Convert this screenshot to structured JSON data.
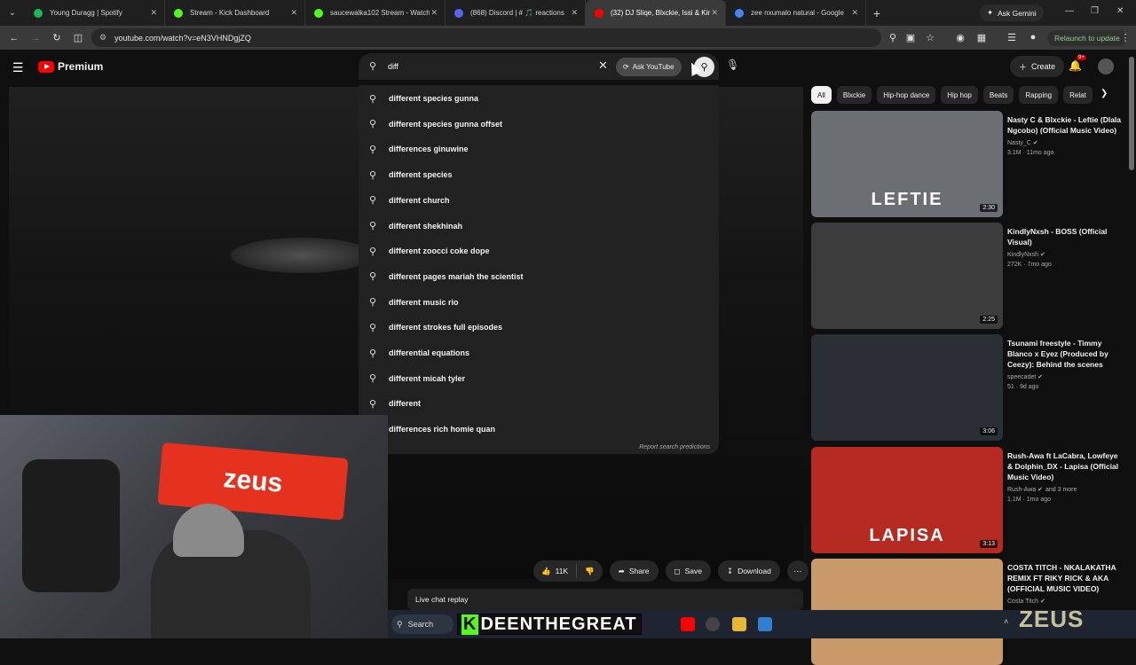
{
  "browser": {
    "tabs": [
      {
        "title": "Young Duragg | Spotify",
        "color": "#1db954",
        "active": false
      },
      {
        "title": "Stream - Kick Dashboard",
        "color": "#53fc18",
        "active": false
      },
      {
        "title": "saucewalka102 Stream - Watch",
        "color": "#53fc18",
        "active": false
      },
      {
        "title": "(868) Discord | # 🎵 reactions",
        "color": "#5865f2",
        "active": false
      },
      {
        "title": "(32) DJ Sliqe, Blxckie, Issi & Kin",
        "color": "#ff0000",
        "active": true
      },
      {
        "title": "zee nxumalo natural - Google",
        "color": "#4285f4",
        "active": false
      }
    ],
    "new_tab": "+",
    "gemini_label": "Ask Gemini",
    "url": "youtube.com/watch?v=eN3VHNDgjZQ",
    "relaunch_label": "Relaunch to update"
  },
  "youtube": {
    "logo_text": "Premium",
    "search": {
      "value": "diff",
      "ask_label": "Ask YouTube",
      "suggestions": [
        "different species gunna",
        "different species gunna offset",
        "differences ginuwine",
        "different species",
        "different church",
        "different shekhinah",
        "different zoocci coke dope",
        "different pages mariah the scientist",
        "different music rio",
        "different strokes full episodes",
        "differential equations",
        "different micah tyler",
        "different",
        "differences rich homie quan"
      ],
      "report_label": "Report search predictions"
    },
    "create_label": "Create",
    "notif_count": "9+",
    "actions": {
      "likes": "11K",
      "share": "Share",
      "save": "Save",
      "download": "Download"
    },
    "live_chat": "Live chat replay",
    "chips": [
      "All",
      "Blxckie",
      "Hip-hop dance",
      "Hip hop",
      "Beats",
      "Rapping",
      "Relat"
    ],
    "recommendations": [
      {
        "title": "Nasty C & Blxckie - Leftie (Dlala Ngcobo) (Official Music Video)",
        "channel": "Nasty_C",
        "meta": "3.1M · 11mo ago",
        "duration": "2:30",
        "overlay": "LEFTIE",
        "bg": "#6b6e73"
      },
      {
        "title": "KindlyNxsh - BOSS (Official Visual)",
        "channel": "KindlyNxsh",
        "meta": "272K · 7mo ago",
        "duration": "2:25",
        "overlay": "",
        "bg": "#3c3c3c"
      },
      {
        "title": "Tsunami freestyle - Timmy Blanco x Eyez (Produced by Ceezy): Behind the scenes",
        "channel": "speecadet",
        "meta": "51 · 9d ago",
        "duration": "3:06",
        "overlay": "",
        "bg": "#2a2f36"
      },
      {
        "title": "Rush-Awa ft LaCabra, Lowfeye & Dolphin_DX - Lapisa (Official Music Video)",
        "channel": "Rush-Awa",
        "channel_extra": "and 3 more",
        "meta": "1.1M · 1mo ago",
        "duration": "3:13",
        "overlay": "LAPISA",
        "bg": "#b52b22"
      },
      {
        "title": "COSTA TITCH - NKALAKATHA REMIX FT RIKY RICK & AKA (OFFICIAL MUSIC VIDEO)",
        "channel": "Costa Titch",
        "meta": "",
        "duration": "",
        "overlay": "",
        "bg": "#c89a6a"
      }
    ]
  },
  "stream": {
    "banner": "zeus",
    "taskbar_search": "Search",
    "streamer_tag": "DEENTHEGREAT",
    "watermark": "ZEUS"
  }
}
